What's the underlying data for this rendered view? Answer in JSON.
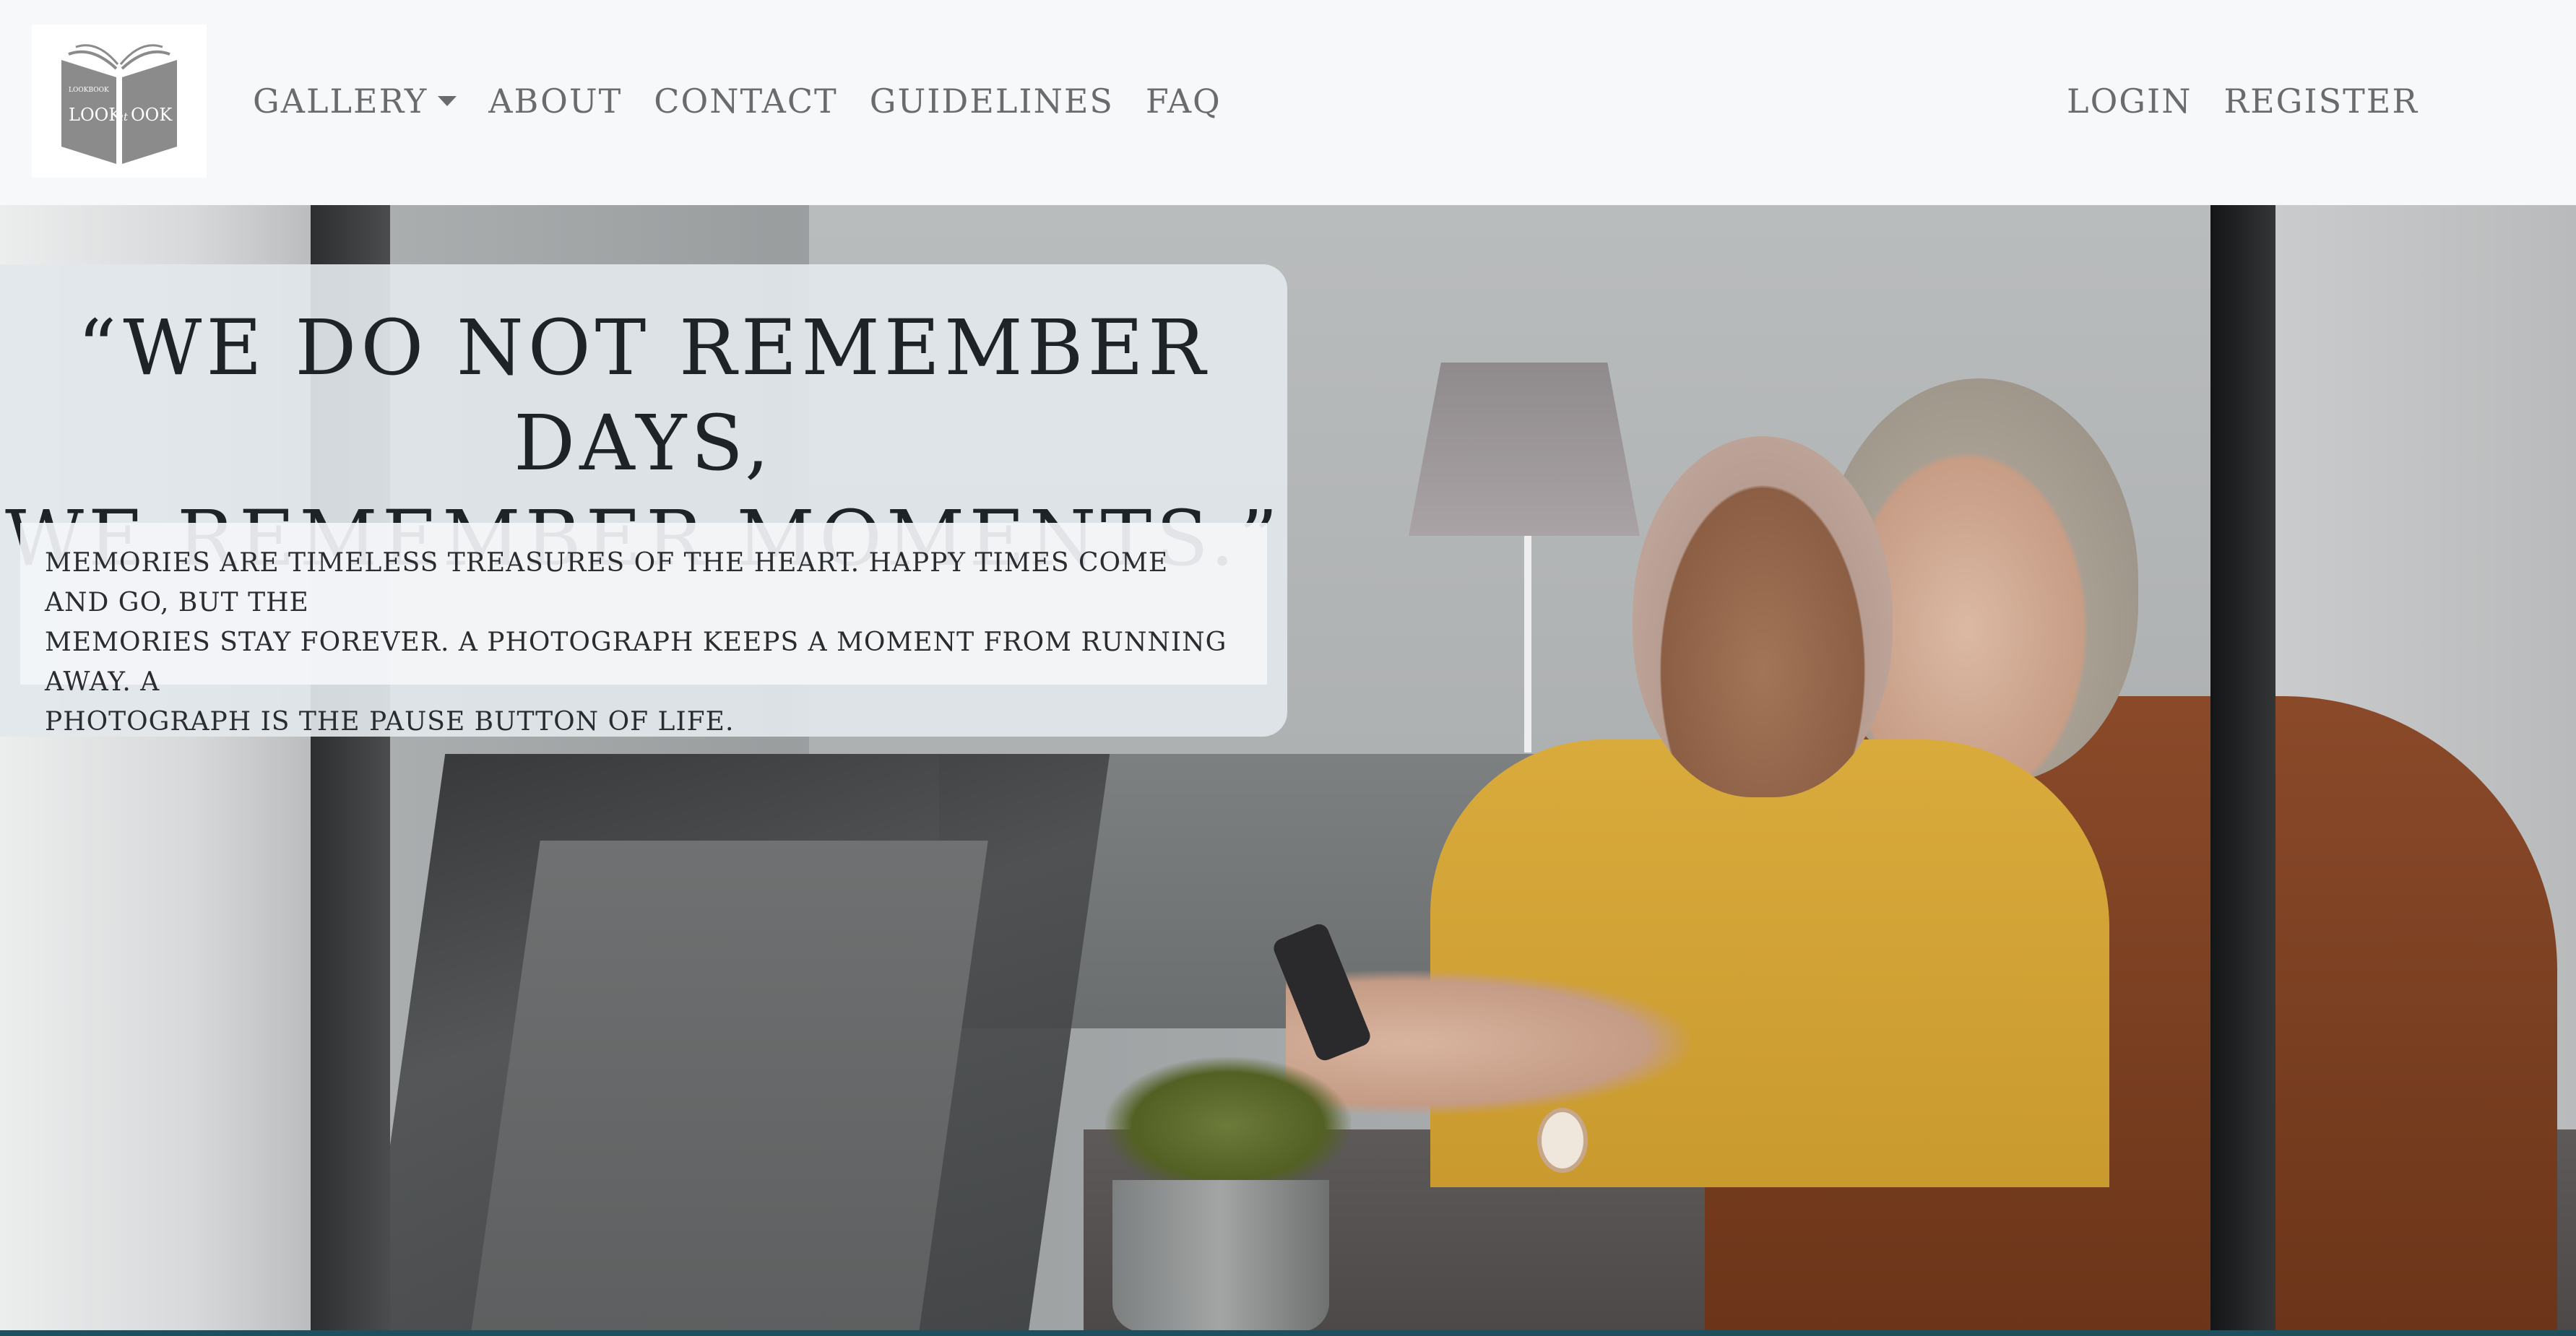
{
  "navbar": {
    "logo": {
      "small_text": "LOOKBOOK",
      "wordmark_left": "LOOK",
      "wordmark_mid": "at",
      "wordmark_right": "OOK"
    },
    "left_links": [
      {
        "label": "GALLERY",
        "has_dropdown": true
      },
      {
        "label": "ABOUT"
      },
      {
        "label": "CONTACT"
      },
      {
        "label": "GUIDELINES"
      },
      {
        "label": "FAQ"
      }
    ],
    "right_links": [
      {
        "label": "LOGIN"
      },
      {
        "label": "REGISTER"
      }
    ]
  },
  "hero": {
    "quote_line_1": "“WE DO NOT REMEMBER DAYS,",
    "quote_line_2": "WE REMEMBER MOMENTS.”",
    "body_line_1": "MEMORIES ARE TIMELESS TREASURES OF THE HEART. HAPPY TIMES COME AND GO, BUT THE",
    "body_line_2": "MEMORIES STAY FOREVER. A PHOTOGRAPH KEEPS A MOMENT FROM RUNNING AWAY. A",
    "body_line_3": "PHOTOGRAPH IS THE PAUSE BUTTON OF LIFE."
  },
  "colors": {
    "nav_background": "#f7f8fa",
    "nav_text": "#6b6b6b",
    "card_background": "#e2e7ec",
    "quote_text": "#1d2326"
  },
  "icons": {
    "logo": "open-book-logo-icon",
    "dropdown": "caret-down-icon"
  }
}
